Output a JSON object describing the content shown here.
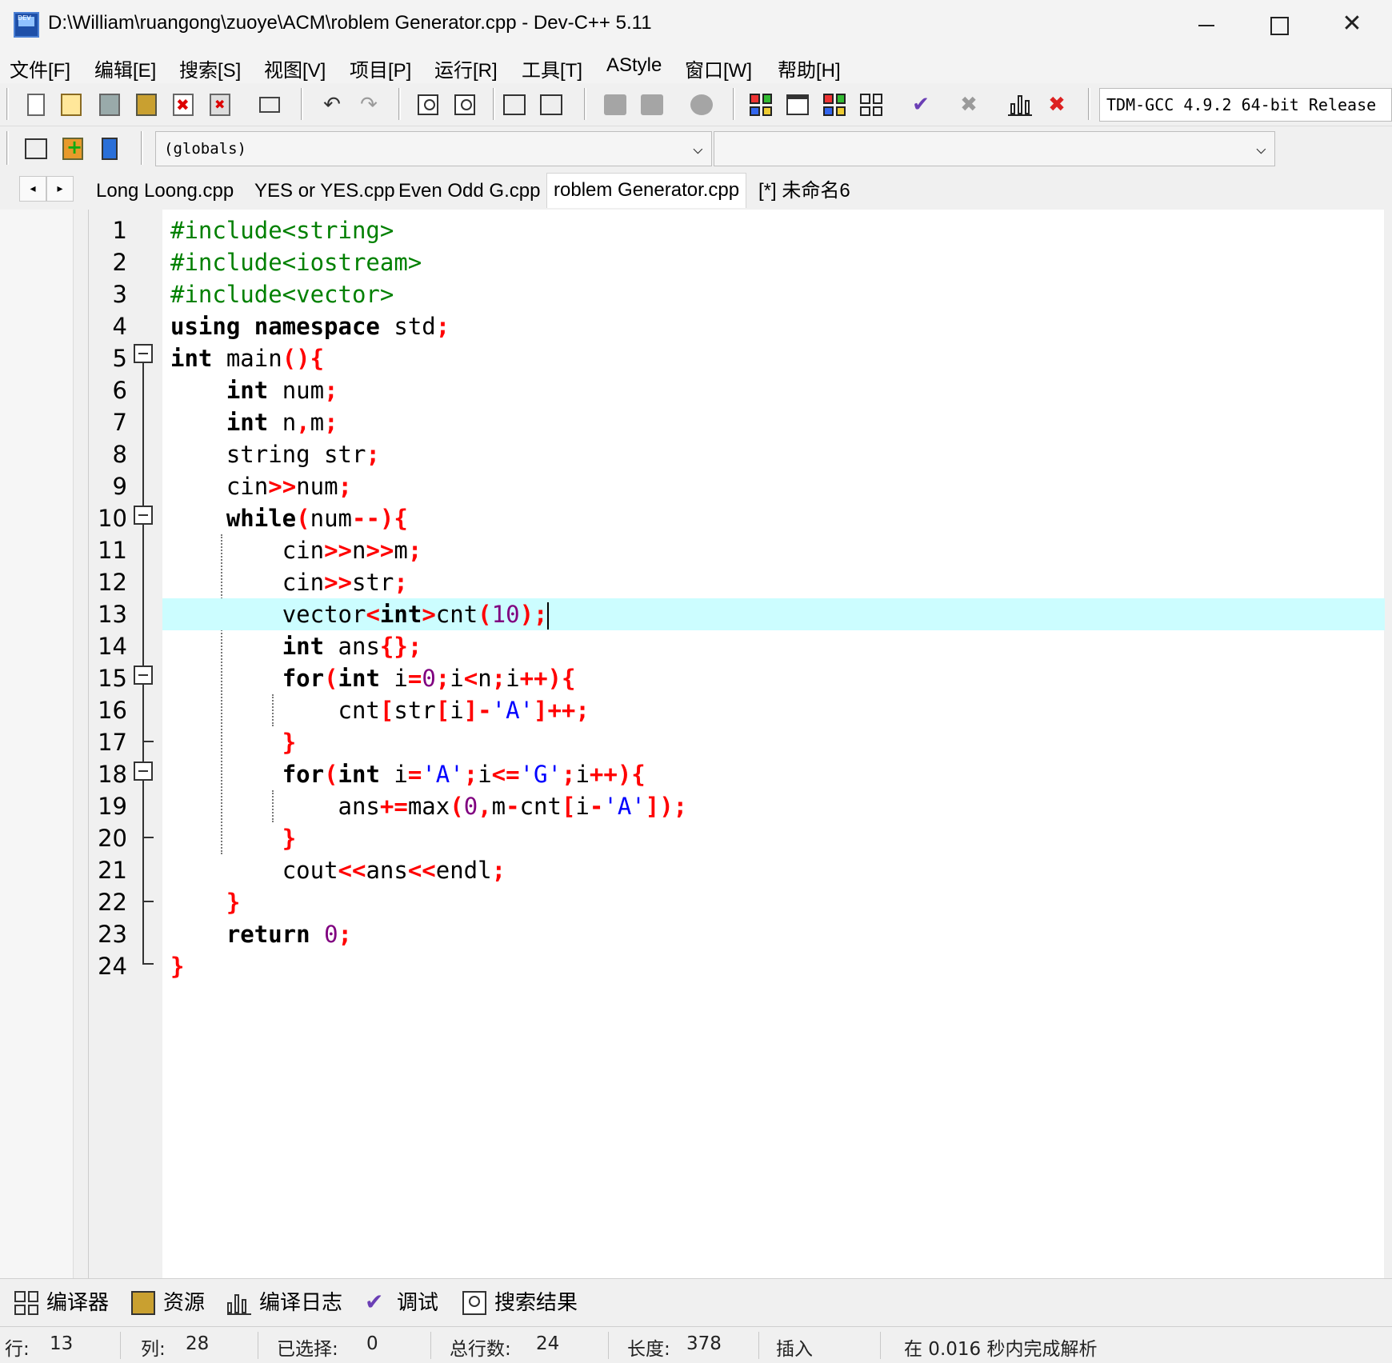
{
  "window": {
    "title": "D:\\William\\ruangong\\zuoye\\ACM\\roblem Generator.cpp - Dev-C++ 5.11",
    "icon_label": "DEV",
    "buttons": {
      "minimize": "minimize-icon",
      "maximize": "maximize-icon",
      "close": "✕"
    }
  },
  "menu": [
    "文件[F]",
    "编辑[E]",
    "搜索[S]",
    "视图[V]",
    "项目[P]",
    "运行[R]",
    "工具[T]",
    "AStyle",
    "窗口[W]",
    "帮助[H]"
  ],
  "toolbar": {
    "compiler": "TDM-GCC 4.9.2 64-bit Release",
    "icons": [
      "new-file-icon",
      "open-file-icon",
      "save-icon",
      "save-all-icon",
      "close-file-icon",
      "close-all-icon",
      "print-icon",
      "undo-icon",
      "redo-icon",
      "find-icon",
      "replace-icon",
      "indent-icon",
      "unindent-icon",
      "goto-prev-icon",
      "goto-next-icon",
      "toggle-bookmark-icon",
      "new-project-icon",
      "project-window-icon",
      "compile-run-icon",
      "rebuild-icon",
      "syntax-check-icon",
      "stop-icon",
      "profile-icon",
      "delete-profile-icon"
    ]
  },
  "toolbar2": {
    "icons": [
      "insert-icon",
      "add-file-icon",
      "class-browser-icon"
    ],
    "scope_combo": "(globals)",
    "symbol_combo": ""
  },
  "tabs": [
    {
      "label": "Long Loong.cpp",
      "active": false
    },
    {
      "label": "YES or YES.cpp",
      "active": false
    },
    {
      "label": "Even Odd G.cpp",
      "active": false
    },
    {
      "label": "roblem Generator.cpp",
      "active": true
    },
    {
      "label": "[*] 未命名6",
      "active": false
    }
  ],
  "tab_nav": {
    "prev": "◂",
    "next": "▸"
  },
  "editor": {
    "current_line": 13,
    "line_numbers": [
      "1",
      "2",
      "3",
      "4",
      "5",
      "6",
      "7",
      "8",
      "9",
      "10",
      "11",
      "12",
      "13",
      "14",
      "15",
      "16",
      "17",
      "18",
      "19",
      "20",
      "21",
      "22",
      "23",
      "24"
    ],
    "code": {
      "l1": "#include<string>",
      "l2": "#include<iostream>",
      "l3": "#include<vector>",
      "l4_a": "using namespace",
      "l4_b": " std",
      "l4_c": ";",
      "l5_a": "int",
      "l5_b": " main",
      "l5_c": "(){",
      "l6_a": "int",
      "l6_b": " num",
      "l6_c": ";",
      "l7_a": "int",
      "l7_b": " n",
      "l7_c": ",",
      "l7_d": "m",
      "l7_e": ";",
      "l8_a": "string str",
      "l8_b": ";",
      "l9_a": "cin",
      "l9_b": ">>",
      "l9_c": "num",
      "l9_d": ";",
      "l10_a": "while",
      "l10_b": "(",
      "l10_c": "num",
      "l10_d": "--){",
      "l11_a": "cin",
      "l11_b": ">>",
      "l11_c": "n",
      "l11_d": ">>",
      "l11_e": "m",
      "l11_f": ";",
      "l12_a": "cin",
      "l12_b": ">>",
      "l12_c": "str",
      "l12_d": ";",
      "l13_a": "vector",
      "l13_b": "<",
      "l13_c": "int",
      "l13_d": ">",
      "l13_e": "cnt",
      "l13_f": "(",
      "l13_g": "10",
      "l13_h": ");",
      "l14_a": "int",
      "l14_b": " ans",
      "l14_c": "{};",
      "l15_a": "for",
      "l15_b": "(",
      "l15_c": "int",
      "l15_d": " i",
      "l15_e": "=",
      "l15_f": "0",
      "l15_g": ";",
      "l15_h": "i",
      "l15_i": "<",
      "l15_j": "n",
      "l15_k": ";",
      "l15_l": "i",
      "l15_m": "++){",
      "l16_a": "cnt",
      "l16_b": "[",
      "l16_c": "str",
      "l16_d": "[",
      "l16_e": "i",
      "l16_f": "]-",
      "l16_g": "'A'",
      "l16_h": "]++;",
      "l17": "}",
      "l18_a": "for",
      "l18_b": "(",
      "l18_c": "int",
      "l18_d": " i",
      "l18_e": "=",
      "l18_f": "'A'",
      "l18_g": ";",
      "l18_h": "i",
      "l18_i": "<=",
      "l18_j": "'G'",
      "l18_k": ";",
      "l18_l": "i",
      "l18_m": "++){",
      "l19_a": "ans",
      "l19_b": "+=",
      "l19_c": "max",
      "l19_d": "(",
      "l19_e": "0",
      "l19_f": ",",
      "l19_g": "m",
      "l19_h": "-",
      "l19_i": "cnt",
      "l19_j": "[",
      "l19_k": "i",
      "l19_l": "-",
      "l19_m": "'A'",
      "l19_n": "]);",
      "l20": "}",
      "l21_a": "cout",
      "l21_b": "<<",
      "l21_c": "ans",
      "l21_d": "<<",
      "l21_e": "endl",
      "l21_f": ";",
      "l22": "}",
      "l23_a": "return",
      "l23_b": " ",
      "l23_c": "0",
      "l23_d": ";",
      "l24": "}"
    }
  },
  "bottom_tabs": [
    {
      "label": "编译器",
      "icon": "compiler-icon"
    },
    {
      "label": "资源",
      "icon": "resources-icon"
    },
    {
      "label": "编译日志",
      "icon": "compile-log-icon"
    },
    {
      "label": "调试",
      "icon": "debug-icon"
    },
    {
      "label": "搜索结果",
      "icon": "search-results-icon"
    }
  ],
  "status": {
    "row_label": "行:",
    "row_value": "13",
    "col_label": "列:",
    "col_value": "28",
    "sel_label": "已选择:",
    "sel_value": "0",
    "lines_label": "总行数:",
    "lines_value": "24",
    "len_label": "长度:",
    "len_value": "378",
    "mode": "插入",
    "parse_msg": "在 0.016 秒内完成解析"
  },
  "colors": {
    "current_line_bg": "#ccfdff",
    "preprocessor": "#008000",
    "symbol": "#ff0000",
    "number": "#800080",
    "string_char": "#0000ff"
  }
}
